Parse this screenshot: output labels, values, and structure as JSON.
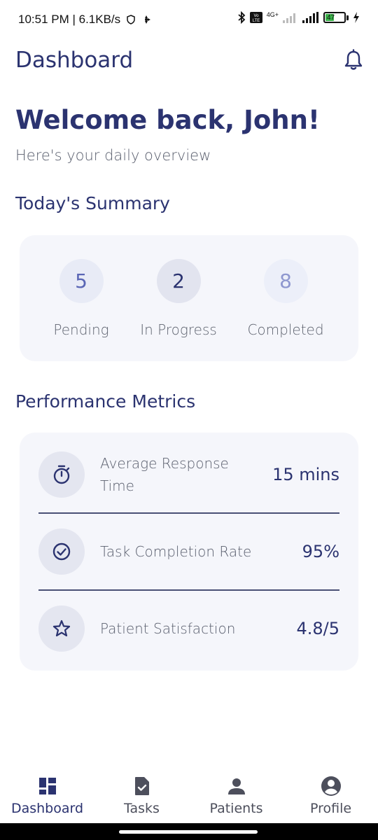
{
  "status_bar": {
    "time_speed": "10:51 PM | 6.1KB/s",
    "network": "4G+",
    "battery": "47"
  },
  "header": {
    "title": "Dashboard",
    "bell_icon": "notification-bell-icon"
  },
  "welcome": {
    "greeting": "Welcome back, John!",
    "subtitle": "Here's your daily overview"
  },
  "summary": {
    "title": "Today's Summary",
    "stats": [
      {
        "value": "5",
        "label": "Pending",
        "bg": "#e8ebf6",
        "color": "#5a66b5"
      },
      {
        "value": "2",
        "label": "In Progress",
        "bg": "#e2e4ef",
        "color": "#2b3370"
      },
      {
        "value": "8",
        "label": "Completed",
        "bg": "#eceff9",
        "color": "#8e97cf"
      }
    ]
  },
  "metrics": {
    "title": "Performance Metrics",
    "items": [
      {
        "icon": "timer-icon",
        "label": "Average Response Time",
        "value": "15 mins"
      },
      {
        "icon": "check-circle-icon",
        "label": "Task Completion Rate",
        "value": "95%"
      },
      {
        "icon": "star-icon",
        "label": "Patient Satisfaction",
        "value": "4.8/5"
      }
    ]
  },
  "bottom_nav": {
    "items": [
      {
        "icon": "dashboard-icon",
        "label": "Dashboard",
        "active": true
      },
      {
        "icon": "tasks-icon",
        "label": "Tasks",
        "active": false
      },
      {
        "icon": "person-icon",
        "label": "Patients",
        "active": false
      },
      {
        "icon": "account-circle-icon",
        "label": "Profile",
        "active": false
      }
    ]
  },
  "colors": {
    "primary": "#2b3370",
    "card_bg": "#f5f6fb"
  }
}
